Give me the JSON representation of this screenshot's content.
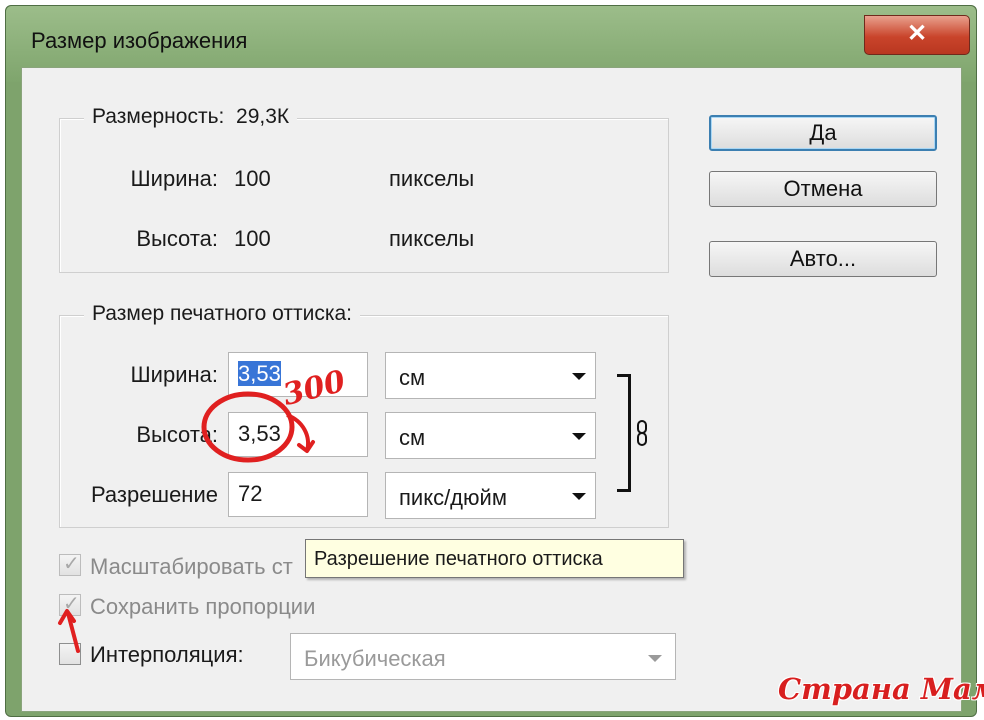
{
  "window": {
    "title": "Размер изображения",
    "close_label": "✕"
  },
  "pixel_dimensions": {
    "legend": "Размерность:",
    "size_value": "29,3К",
    "width_label": "Ширина:",
    "width_value": "100",
    "width_unit": "пикселы",
    "height_label": "Высота:",
    "height_value": "100",
    "height_unit": "пикселы"
  },
  "document_size": {
    "legend": "Размер печатного оттиска:",
    "width_label": "Ширина:",
    "width_value": "3,53",
    "width_unit": "см",
    "height_label": "Высота:",
    "height_value": "3,53",
    "height_unit": "см",
    "resolution_label": "Разрешение",
    "resolution_value": "72",
    "resolution_unit": "пикс/дюйм"
  },
  "buttons": {
    "ok": "Да",
    "cancel": "Отмена",
    "auto": "Авто..."
  },
  "options": {
    "scale_styles_label": "Масштабировать ст",
    "scale_styles_checked": true,
    "constrain_label": "Сохранить пропорции",
    "constrain_checked": true,
    "resample_label": "Интерполяция:",
    "resample_checked": false,
    "resample_method": "Бикубическая"
  },
  "tooltip": {
    "text": "Разрешение печатного оттиска"
  },
  "annotation": {
    "handwritten_value": "300"
  },
  "watermark": {
    "text": "Страна Мам"
  },
  "colors": {
    "titlebar": "#8fb27d",
    "close_button": "#c9442b",
    "selection": "#3875d7",
    "annotation": "#e02020",
    "tooltip_bg": "#ffffe1"
  }
}
